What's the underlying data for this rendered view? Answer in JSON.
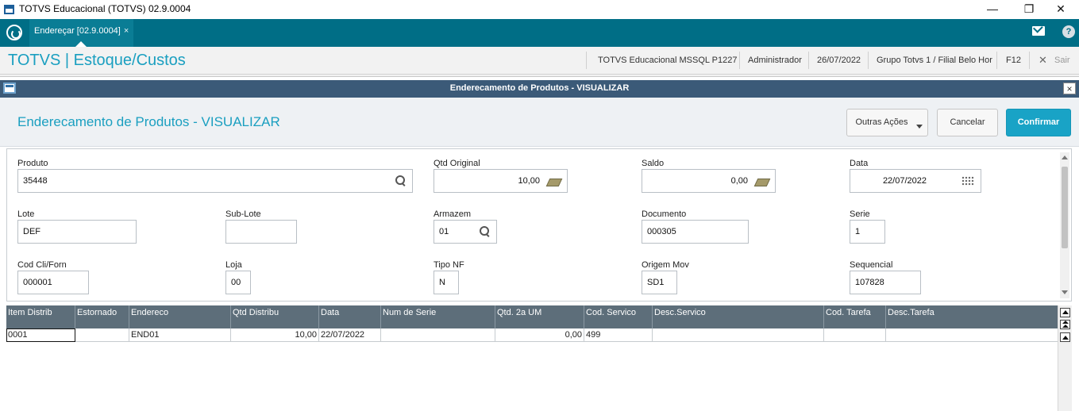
{
  "window": {
    "title": "TOTVS Educacional (TOTVS) 02.9.0004",
    "minimize_glyph": "—",
    "restore_glyph": "❐",
    "close_glyph": "✕"
  },
  "tabs": [
    {
      "label": "Endereçar [02.9.0004]",
      "close": "×"
    }
  ],
  "module": {
    "title": "TOTVS | Estoque/Custos",
    "environment": "TOTVS Educacional MSSQL P1227",
    "user": "Administrador",
    "date": "26/07/2022",
    "branch": "Grupo Totvs 1 / Filial Belo Hor",
    "shortcut": "F12",
    "exit_label": "Sair",
    "exit_glyph": "✕"
  },
  "dialog": {
    "title": "Enderecamento de Produtos - VISUALIZAR",
    "close_glyph": "×",
    "heading": "Enderecamento de Produtos - VISUALIZAR",
    "buttons": {
      "other_actions": "Outras Ações",
      "cancel": "Cancelar",
      "confirm": "Confirmar"
    }
  },
  "form": {
    "produto": {
      "label": "Produto",
      "value": "35448"
    },
    "qtd_original": {
      "label": "Qtd Original",
      "value": "10,00"
    },
    "saldo": {
      "label": "Saldo",
      "value": "0,00"
    },
    "data": {
      "label": "Data",
      "value": "22/07/2022"
    },
    "lote": {
      "label": "Lote",
      "value": "DEF"
    },
    "sub_lote": {
      "label": "Sub-Lote",
      "value": ""
    },
    "armazem": {
      "label": "Armazem",
      "value": "01"
    },
    "documento": {
      "label": "Documento",
      "value": "000305"
    },
    "serie": {
      "label": "Serie",
      "value": "1"
    },
    "cod_cli_forn": {
      "label": "Cod Cli/Forn",
      "value": "000001"
    },
    "loja": {
      "label": "Loja",
      "value": "00"
    },
    "tipo_nf": {
      "label": "Tipo NF",
      "value": "N"
    },
    "origem_mov": {
      "label": "Origem Mov",
      "value": "SD1"
    },
    "sequencial": {
      "label": "Sequencial",
      "value": "107828"
    }
  },
  "grid": {
    "headers": [
      "Item Distrib",
      "Estornado",
      "Endereco",
      "Qtd Distribu",
      "Data",
      "Num de Serie",
      "Qtd. 2a UM",
      "Cod. Servico",
      "Desc.Servico",
      "Cod. Tarefa",
      "Desc.Tarefa"
    ],
    "rows": [
      [
        "0001",
        "",
        "END01",
        "10,00",
        "22/07/2022",
        "",
        "0,00",
        "499",
        "",
        "",
        ""
      ]
    ]
  }
}
